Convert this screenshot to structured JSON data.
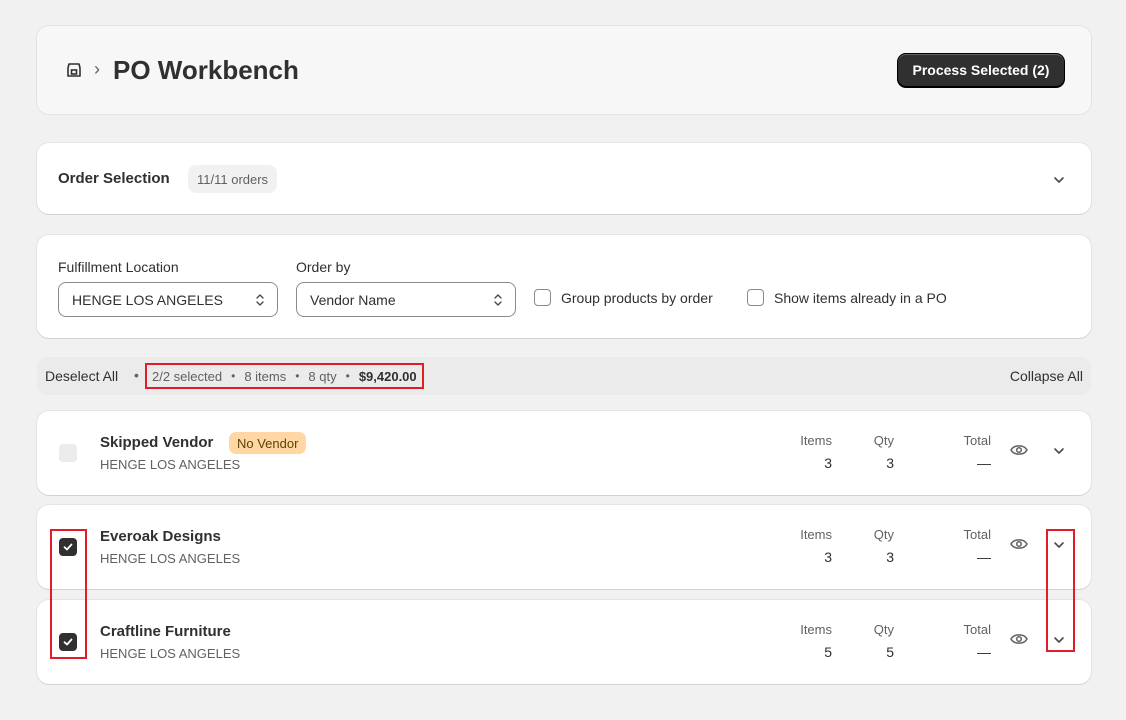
{
  "header": {
    "title": "PO Workbench",
    "process_button": "Process Selected (2)"
  },
  "order_selection": {
    "label": "Order Selection",
    "count_badge": "11/11 orders"
  },
  "filters": {
    "location_label": "Fulfillment Location",
    "location_value": "HENGE LOS ANGELES",
    "order_by_label": "Order by",
    "order_by_value": "Vendor Name",
    "group_products_label": "Group products by order",
    "show_items_label": "Show items already in a PO"
  },
  "summary": {
    "deselect_label": "Deselect All",
    "selected": "2/2 selected",
    "items": "8 items",
    "qty": "8 qty",
    "total": "$9,420.00",
    "collapse_label": "Collapse All"
  },
  "columns": {
    "items": "Items",
    "qty": "Qty",
    "total": "Total"
  },
  "vendors": [
    {
      "name": "Skipped Vendor",
      "badge": "No Vendor",
      "location": "HENGE LOS ANGELES",
      "items": "3",
      "qty": "3",
      "total": "—",
      "checked": false,
      "disabled": true
    },
    {
      "name": "Everoak Designs",
      "location": "HENGE LOS ANGELES",
      "items": "3",
      "qty": "3",
      "total": "—",
      "checked": true
    },
    {
      "name": "Craftline Furniture",
      "location": "HENGE LOS ANGELES",
      "items": "5",
      "qty": "5",
      "total": "—",
      "checked": true
    }
  ],
  "colors": {
    "primary_button": "#303030",
    "highlight": "#e11d2a",
    "no_vendor_badge": "#ffd6a4"
  }
}
